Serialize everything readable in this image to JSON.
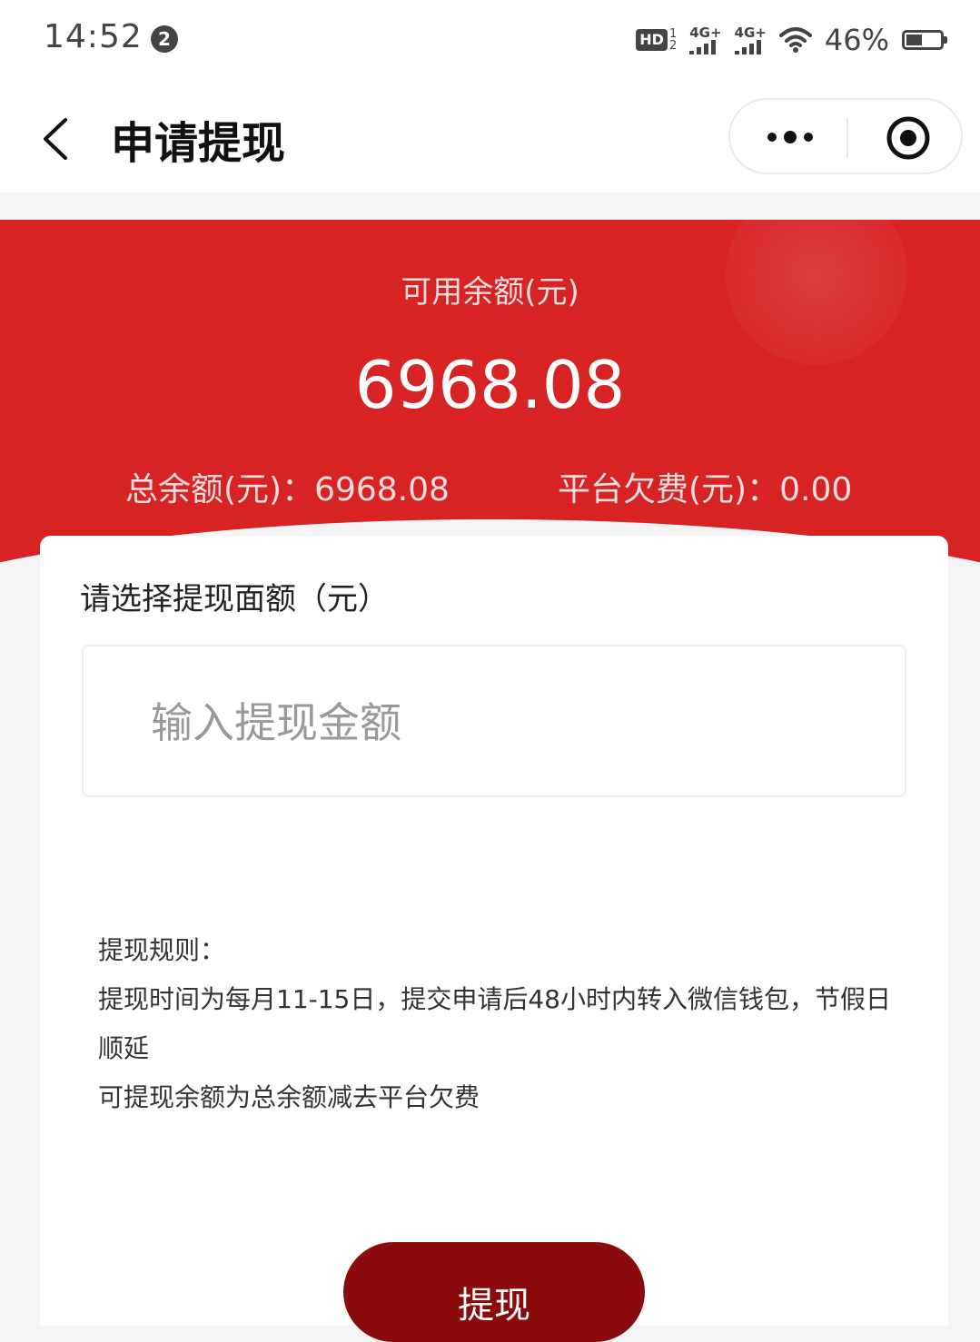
{
  "status_bar": {
    "time": "14:52",
    "notification_count": "2",
    "hd_label": "HD",
    "hd_sub_top": "1",
    "hd_sub_bottom": "2",
    "sim1_label": "4G+",
    "sim2_label": "4G+",
    "battery_percent": "46%",
    "battery_level": 0.46
  },
  "nav": {
    "title": "申请提现"
  },
  "balance": {
    "available_label": "可用余额(元)",
    "available_value": "6968.08",
    "total_text": "总余额(元)：6968.08",
    "fee_text": "平台欠费(元)：0.00"
  },
  "form": {
    "label": "请选择提现面额（元）",
    "amount_value": "",
    "amount_placeholder": "输入提现金额"
  },
  "rules": {
    "title": "提现规则：",
    "line1": "提现时间为每月11-15日，提交申请后48小时内转入微信钱包，节假日顺延",
    "line2": "可提现余额为总余额减去平台欠费"
  },
  "submit": {
    "label": "提现"
  },
  "colors": {
    "banner_red": "#d82324",
    "button_dark_red": "#8b0a0c"
  }
}
